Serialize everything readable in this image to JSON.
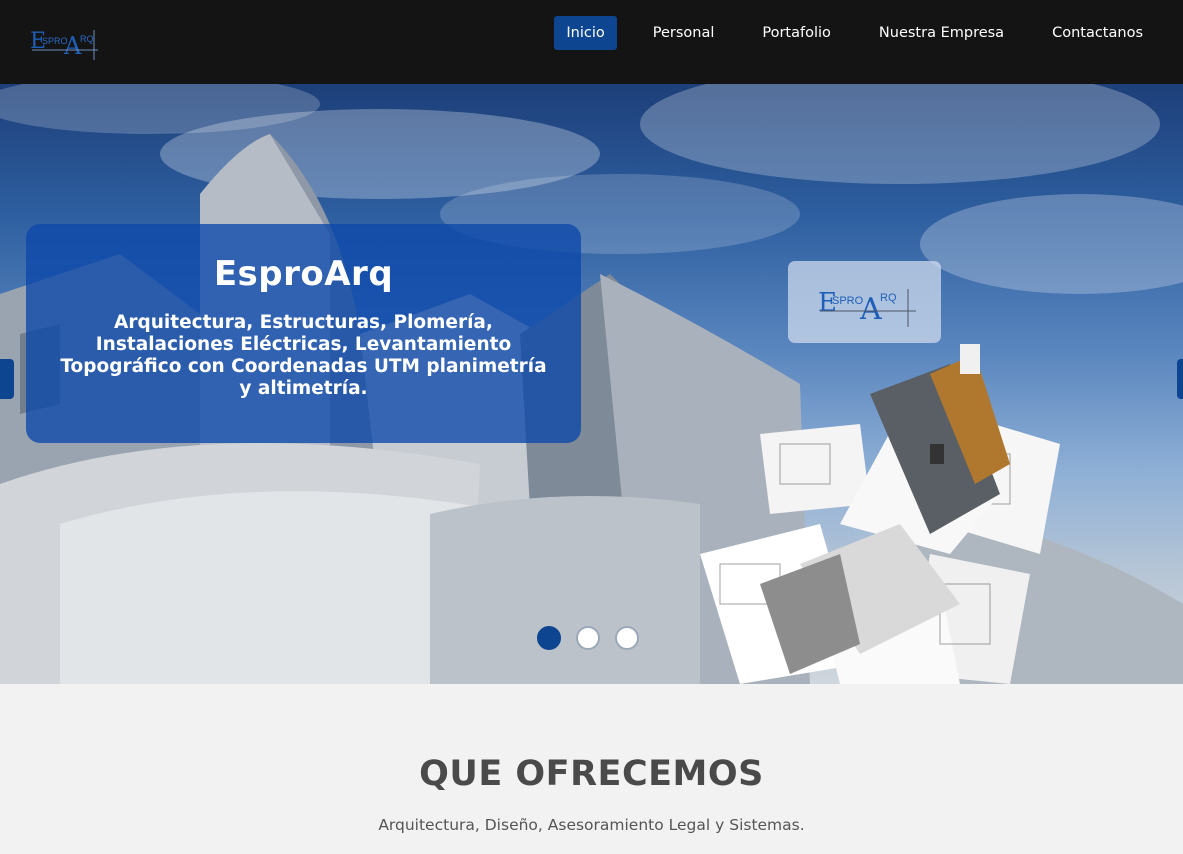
{
  "brand": {
    "logo_icon": "espro-arq-logo",
    "accent_color": "#0d4590"
  },
  "nav": {
    "items": [
      {
        "label": "Inicio",
        "active": true
      },
      {
        "label": "Personal",
        "active": false
      },
      {
        "label": "Portafolio",
        "active": false
      },
      {
        "label": "Nuestra Empresa",
        "active": false
      },
      {
        "label": "Contactanos",
        "active": false
      }
    ]
  },
  "hero": {
    "title": "EsproArq",
    "text": "Arquitectura, Estructuras, Plomería, Instalaciones Eléctricas, Levantamiento Topográfico con Coordenadas UTM planimetría y altimetría.",
    "slides": 3,
    "active_slide": 1
  },
  "section": {
    "title": "QUE OFRECEMOS",
    "subtitle": "Arquitectura, Diseño, Asesoramiento Legal y Sistemas."
  }
}
